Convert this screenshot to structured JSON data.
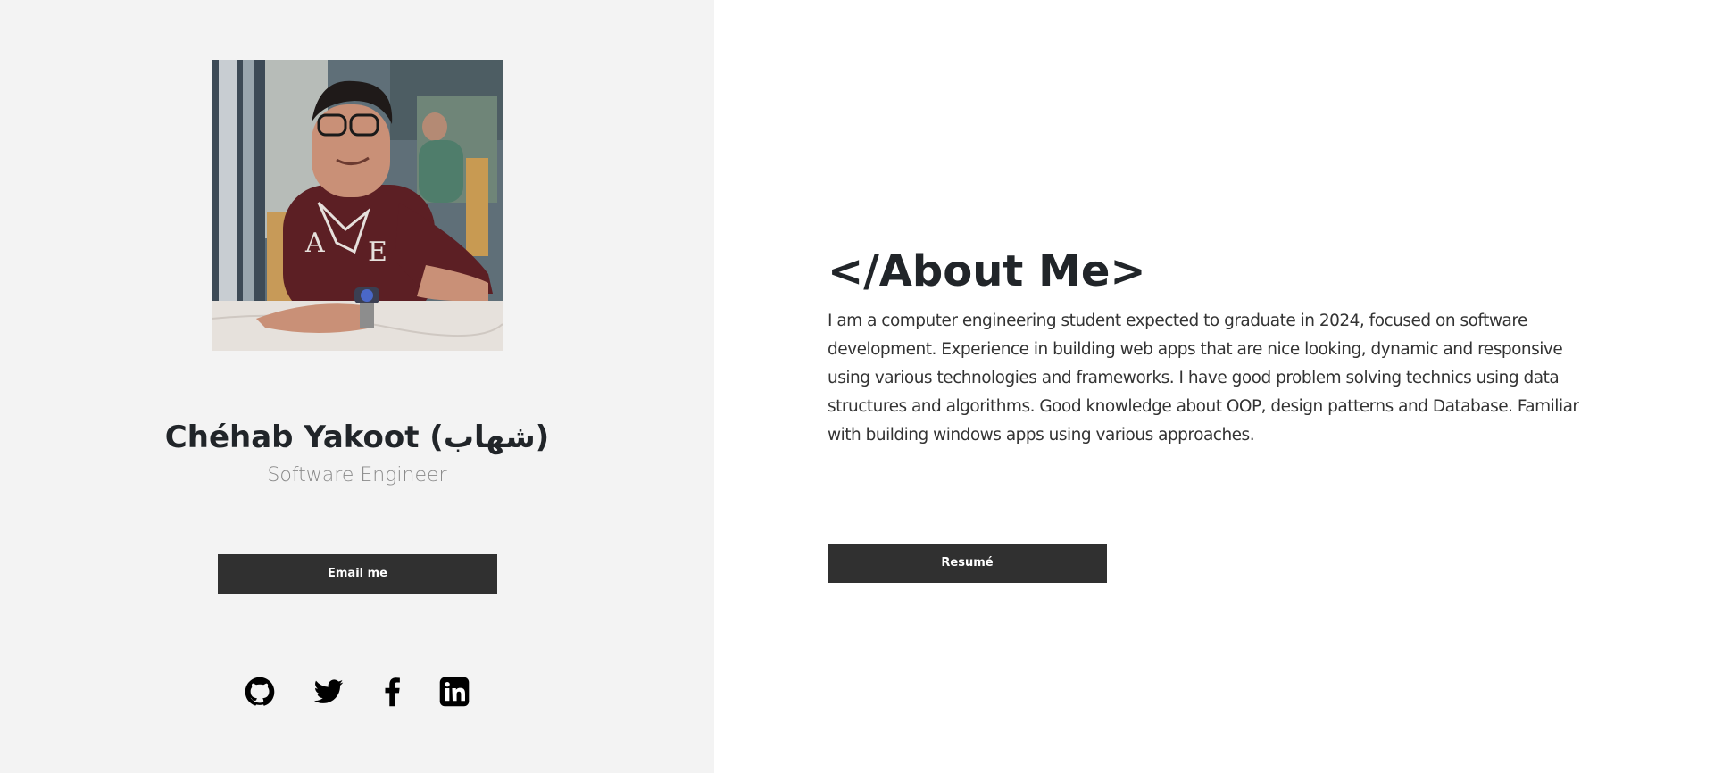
{
  "profile": {
    "photo_alt": "Profile photo",
    "name": "Chéhab Yakoot (شهاب)",
    "role": "Software Engineer",
    "email_button": "Email me",
    "socials": [
      {
        "icon": "github-icon"
      },
      {
        "icon": "twitter-icon"
      },
      {
        "icon": "facebook-icon"
      },
      {
        "icon": "linkedin-icon"
      }
    ]
  },
  "about": {
    "title": "</About Me>",
    "text": "I am a computer engineering student expected to graduate in 2024, focused on software development. Experience in building web apps that are nice looking, dynamic and responsive using various technologies and frameworks. I have good problem solving technics using data structures and algorithms. Good knowledge about OOP, design patterns and Database. Familiar with building windows apps using various approaches.",
    "resume_button": "Resumé"
  },
  "colors": {
    "panel_bg": "#f3f3f3",
    "button_bg": "#303030",
    "button_text": "#ffffff",
    "role_text": "#8a8a8a"
  }
}
